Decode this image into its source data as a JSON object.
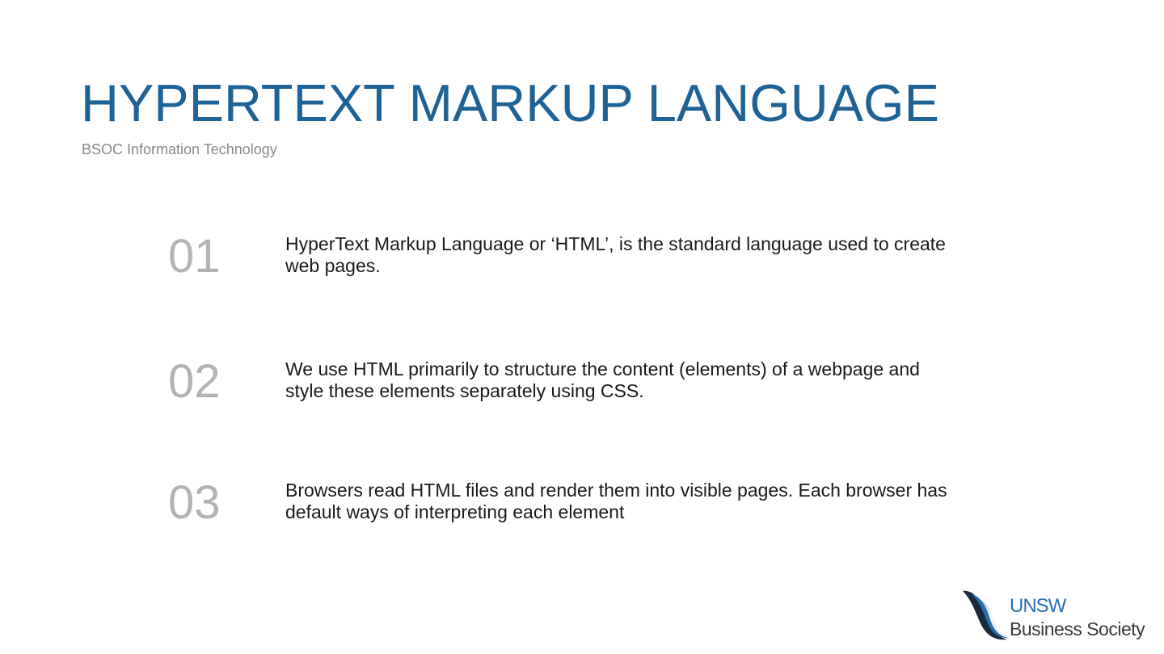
{
  "slide": {
    "title": "HYPERTEXT MARKUP LANGUAGE",
    "subtitle": "BSOC Information Technology",
    "points": [
      {
        "number": "01",
        "text": "HyperText Markup Language or ‘HTML’, is the standard language used to create web pages."
      },
      {
        "number": "02",
        "text": "We use HTML primarily to structure the content (elements) of a webpage and style these elements separately using CSS."
      },
      {
        "number": "03",
        "text": "Browsers read HTML files and render them into visible pages. Each browser has default ways of interpreting each element"
      }
    ]
  },
  "logo": {
    "line1": "UNSW",
    "line2": "Business Society"
  },
  "colors": {
    "title": "#1f6296",
    "subtitle": "#8a8a8a",
    "number": "#b3b3b3",
    "body_text": "#1a1a1a",
    "logo_blue": "#2a6eb1",
    "logo_dark": "#1b2a3a"
  }
}
